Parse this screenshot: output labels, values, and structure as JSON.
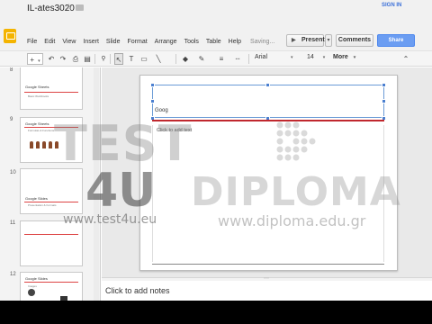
{
  "doc": {
    "title": "IL-ates3020"
  },
  "menu": [
    "File",
    "Edit",
    "View",
    "Insert",
    "Slide",
    "Format",
    "Arrange",
    "Tools",
    "Table",
    "Help"
  ],
  "status": "Saving...",
  "header": {
    "present": "Present",
    "comments": "Comments",
    "share": "Share",
    "signin": "SIGN IN"
  },
  "toolbar": {
    "add": "+",
    "undo": "↶",
    "redo": "↷",
    "paint": "⎙",
    "zoom": "🔍",
    "select": "↖",
    "textbox": "T",
    "shape": "▭",
    "line": "╲",
    "fill": "◆",
    "border_color": "✎",
    "border_weight": "≡",
    "border_dash": "┄",
    "font": "Arial",
    "size": "14",
    "more": "More",
    "collapse": "⌃"
  },
  "slides": [
    {
      "num": "8",
      "title": "Google Sheets",
      "sub": "Basic Workbooks"
    },
    {
      "num": "9",
      "title": "Google Sheets",
      "sub": "Formulas & Functions"
    },
    {
      "num": "10",
      "title": "Google Slides",
      "sub": "Presentation & Formats"
    },
    {
      "num": "11",
      "title": "",
      "sub": ""
    },
    {
      "num": "12",
      "title": "Google Slides",
      "sub": "Images"
    }
  ],
  "slide": {
    "title_text": "Goog",
    "body_placeholder": "Click to add text"
  },
  "notes": {
    "placeholder": "Click to add notes"
  },
  "watermark": {
    "test": "TEST",
    "four_u": "4U",
    "diploma": "DIPLOMA",
    "url1": "www.test4u.eu",
    "url2": "www.diploma.edu.gr"
  },
  "colors": {
    "accent_red": "#c0282e",
    "selection": "#4a7fd0",
    "share_blue": "#6b9df2",
    "logo_yellow": "#f4b400"
  }
}
